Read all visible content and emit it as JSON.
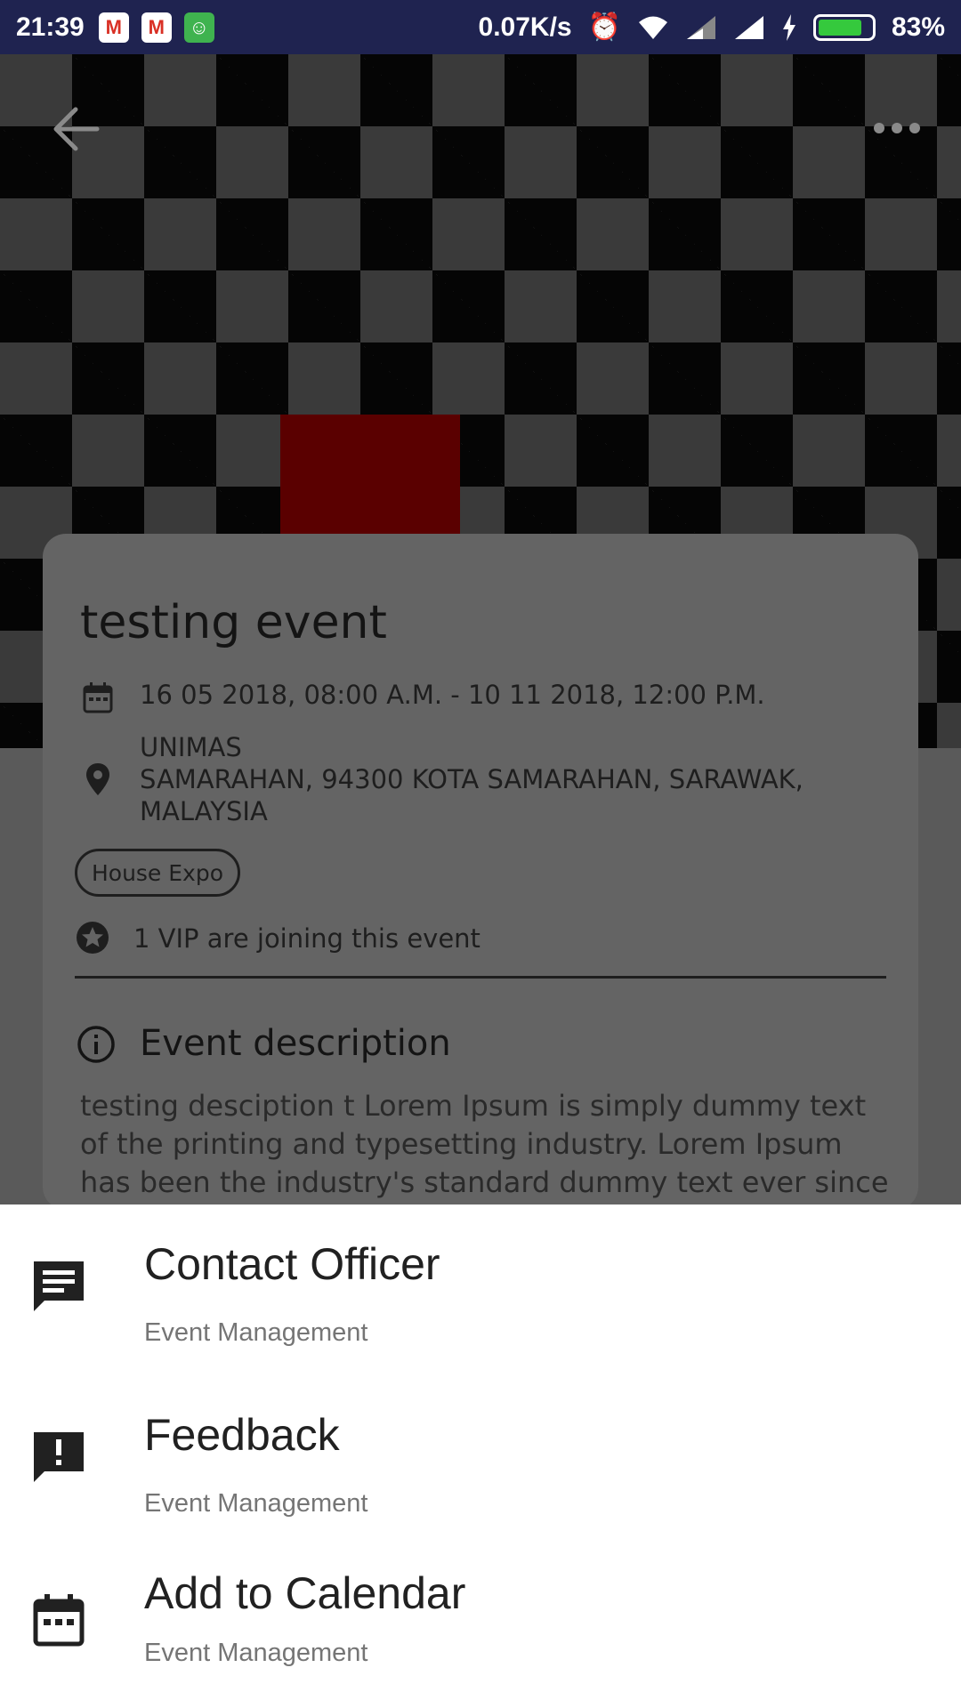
{
  "status_bar": {
    "time": "21:39",
    "net_speed": "0.07K/s",
    "battery_pct": "83%",
    "battery_level": 0.83,
    "icons": [
      "gmail-icon",
      "gmail-icon",
      "android-icon",
      "alarm-icon",
      "wifi-icon",
      "signal-icon",
      "signal-icon",
      "charging-icon",
      "battery-icon"
    ]
  },
  "toolbar": {
    "back_icon": "arrow-back-icon",
    "more_icon": "more-horiz-icon"
  },
  "event": {
    "title": "testing event",
    "date_range": "16 05 2018, 08:00 A.M. - 10 11 2018, 12:00 P.M.",
    "address_line1": "UNIMAS",
    "address_line2": "SAMARAHAN, 94300 KOTA SAMARAHAN, SARAWAK,",
    "address_line3": "MALAYSIA",
    "category_chip": "House Expo",
    "vip_text": "1 VIP are joining this event",
    "description_heading": "Event description",
    "description": "testing desciption t Lorem Ipsum is simply dummy text of the printing and typesetting industry. Lorem Ipsum has been the industry's standard dummy text ever since"
  },
  "sheet": {
    "items": [
      {
        "title": "Contact Officer",
        "subtitle": "Event Management",
        "icon": "message-icon"
      },
      {
        "title": "Feedback",
        "subtitle": "Event Management",
        "icon": "feedback-icon"
      },
      {
        "title": "Add to Calendar",
        "subtitle": "Event Management",
        "icon": "calendar-icon"
      }
    ]
  },
  "colors": {
    "status_bar": "#1f2350",
    "scrim_card": "#646464",
    "sheet_bg": "#ffffff",
    "battery_fill": "#35c93d"
  }
}
